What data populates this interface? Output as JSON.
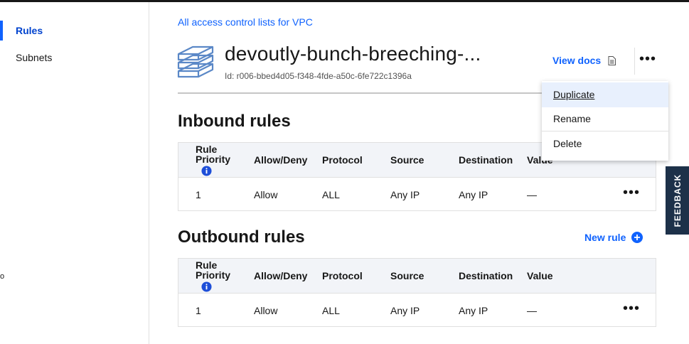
{
  "sidebar": {
    "items": [
      {
        "label": "Rules",
        "active": true
      },
      {
        "label": "Subnets",
        "active": false
      }
    ],
    "stray_char": "o"
  },
  "header": {
    "breadcrumb": "All access control lists for VPC",
    "title": "devoutly-bunch-breeching-...",
    "id_label": "Id: r006-bbed4d05-f348-4fde-a50c-6fe722c1396a",
    "view_docs": "View docs",
    "more_icon": "overflow-menu-icon",
    "more_glyph": "•••"
  },
  "menu": {
    "items": [
      {
        "label": "Duplicate"
      },
      {
        "label": "Rename"
      },
      {
        "label": "Delete"
      }
    ]
  },
  "inbound": {
    "title": "Inbound rules",
    "columns": [
      "Rule Priority",
      "Allow/Deny",
      "Protocol",
      "Source",
      "Destination",
      "Value"
    ],
    "priority_line1": "Rule",
    "priority_line2": "Priority",
    "rows": [
      {
        "priority": "1",
        "action": "Allow",
        "protocol": "ALL",
        "source": "Any IP",
        "destination": "Any IP",
        "value": "—"
      }
    ]
  },
  "outbound": {
    "title": "Outbound rules",
    "new_rule": "New rule",
    "columns": [
      "Rule Priority",
      "Allow/Deny",
      "Protocol",
      "Source",
      "Destination",
      "Value"
    ],
    "priority_line1": "Rule",
    "priority_line2": "Priority",
    "rows": [
      {
        "priority": "1",
        "action": "Allow",
        "protocol": "ALL",
        "source": "Any IP",
        "destination": "Any IP",
        "value": "—"
      }
    ]
  },
  "row_more_glyph": "•••",
  "feedback": "FEEDBACK",
  "colors": {
    "accent": "#0f62fe",
    "table_header_bg": "#f2f4f8",
    "menu_hover_bg": "#e8f0fd",
    "feedback_bg": "#1d3149"
  }
}
